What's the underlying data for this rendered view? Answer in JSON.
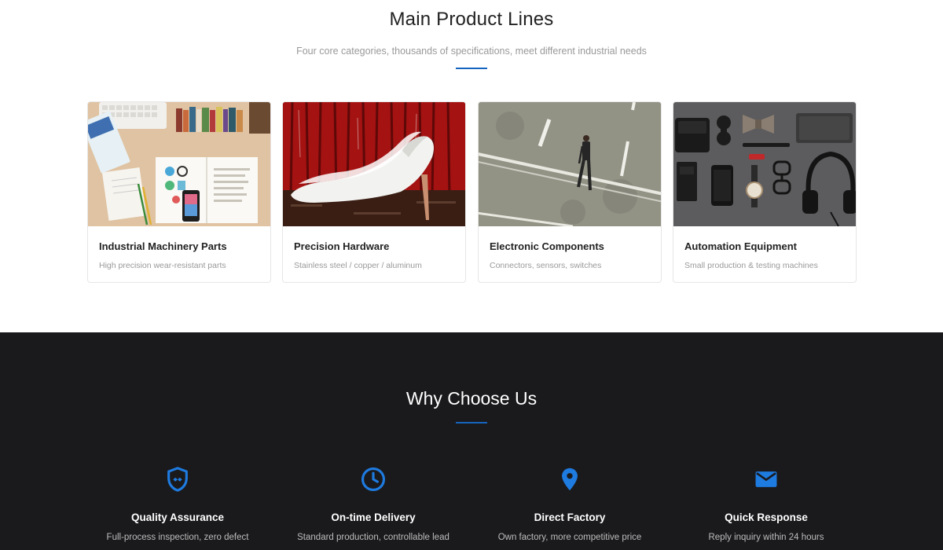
{
  "products": {
    "title": "Main Product Lines",
    "subtitle": "Four core categories, thousands of specifications, meet different industrial needs",
    "accent_color": "#1565c0",
    "cards": [
      {
        "title": "Industrial Machinery Parts",
        "subtitle": "High precision wear-resistant parts",
        "image": "desk-flatlay-photo"
      },
      {
        "title": "Precision Hardware",
        "subtitle": "Stainless steel / copper / aluminum",
        "image": "white-heels-photo"
      },
      {
        "title": "Electronic Components",
        "subtitle": "Connectors, sensors, switches",
        "image": "man-on-road-photo"
      },
      {
        "title": "Automation Equipment",
        "subtitle": "Small production & testing machines",
        "image": "accessories-flatlay-photo"
      }
    ]
  },
  "why": {
    "title": "Why Choose Us",
    "background": "#1a1a1d",
    "icon_color": "#1e7be0",
    "features": [
      {
        "title": "Quality Assurance",
        "subtitle": "Full-process inspection, zero defect",
        "icon": "shield-icon"
      },
      {
        "title": "On-time Delivery",
        "subtitle": "Standard production, controllable lead",
        "icon": "clock-icon"
      },
      {
        "title": "Direct Factory",
        "subtitle": "Own factory, more competitive price",
        "icon": "location-pin-icon"
      },
      {
        "title": "Quick Response",
        "subtitle": "Reply inquiry within 24 hours",
        "icon": "mail-icon"
      }
    ]
  }
}
